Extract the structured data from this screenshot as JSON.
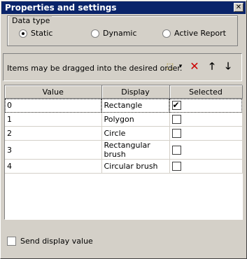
{
  "window": {
    "title": "Properties and settings",
    "close_glyph": "✕"
  },
  "data_type": {
    "legend": "Data type",
    "options": [
      {
        "label": "Static",
        "checked": true
      },
      {
        "label": "Dynamic",
        "checked": false
      },
      {
        "label": "Active Report",
        "checked": false
      }
    ]
  },
  "toolbar": {
    "hint": "Items may be dragged into the desired order.",
    "add_glyph": "⬚",
    "dropdown_glyph": "▾",
    "delete_glyph": "✕",
    "up_glyph": "🡑",
    "down_glyph": "🡓"
  },
  "grid": {
    "columns": [
      "Value",
      "Display",
      "Selected"
    ],
    "rows": [
      {
        "value": "0",
        "display": "Rectangle",
        "selected": true
      },
      {
        "value": "1",
        "display": "Polygon",
        "selected": false
      },
      {
        "value": "2",
        "display": "Circle",
        "selected": false
      },
      {
        "value": "3",
        "display": "Rectangular brush",
        "selected": false
      },
      {
        "value": "4",
        "display": "Circular brush",
        "selected": false
      }
    ]
  },
  "send_display_value": {
    "label": "Send display value",
    "checked": false
  },
  "colors": {
    "title_bar": "#0a246a",
    "face": "#d4d0c8",
    "delete_red": "#cc0000"
  }
}
